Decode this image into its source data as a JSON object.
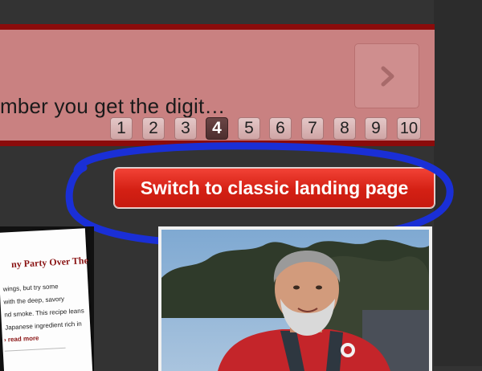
{
  "banner": {
    "text": "mber you get the digit…",
    "next_icon": "chevron-right-icon"
  },
  "pagination": {
    "pages": [
      "1",
      "2",
      "3",
      "4",
      "5",
      "6",
      "7",
      "8",
      "9",
      "10"
    ],
    "active": "4"
  },
  "switch_button": {
    "label": "Switch to classic landing page"
  },
  "cards": {
    "left": {
      "title": "ny Party Over The",
      "lines": [
        "wings, but try some",
        "with the deep, savory",
        "nd smoke. This recipe leans",
        "Japanese ingredient rich in"
      ],
      "more": "› read more"
    }
  },
  "colors": {
    "banner_bg": "#c98181",
    "banner_border": "#8b0b0b",
    "button_red": "#d42014",
    "annotation_blue": "#1a2fd6"
  }
}
